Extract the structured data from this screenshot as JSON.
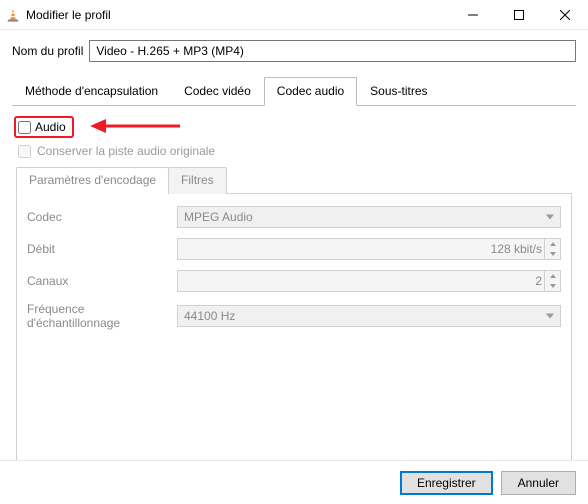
{
  "window": {
    "title": "Modifier le profil"
  },
  "profile": {
    "name_label": "Nom du profil",
    "name_value": "Video - H.265 + MP3 (MP4)"
  },
  "tabs_l1": {
    "encapsulation": "Méthode d'encapsulation",
    "video": "Codec vidéo",
    "audio": "Codec audio",
    "subtitles": "Sous-titres"
  },
  "audio_checkbox_label": "Audio",
  "keep_original_label": "Conserver la piste audio originale",
  "tabs_l2": {
    "params": "Paramètres d'encodage",
    "filters": "Filtres"
  },
  "fields": {
    "codec": {
      "label": "Codec",
      "value": "MPEG Audio"
    },
    "bitrate": {
      "label": "Débit",
      "value": "128 kbit/s"
    },
    "channels": {
      "label": "Canaux",
      "value": "2"
    },
    "samplerate": {
      "label": "Fréquence d'échantillonnage",
      "value": "44100 Hz"
    }
  },
  "buttons": {
    "save": "Enregistrer",
    "cancel": "Annuler"
  }
}
